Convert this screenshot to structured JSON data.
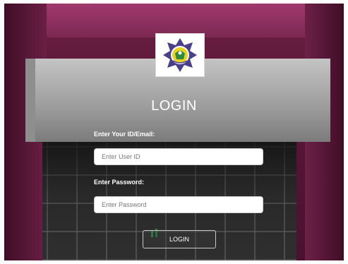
{
  "page": {
    "title": "LOGIN"
  },
  "logo": {
    "icon": "emblem-logo-icon",
    "colors": {
      "star": "#4b3f8a",
      "center": "#e8d21e",
      "accent": "#2d8a3e"
    }
  },
  "form": {
    "id_label": "Enter Your ID/Email:",
    "id_placeholder": "Enter User ID",
    "password_label": "Enter Password:",
    "password_placeholder": "Enter Password",
    "submit_label": "LOGIN"
  },
  "theme": {
    "wall": "#6e2146",
    "beam": "#b5b5b5",
    "glass": "#2a2a2a"
  }
}
